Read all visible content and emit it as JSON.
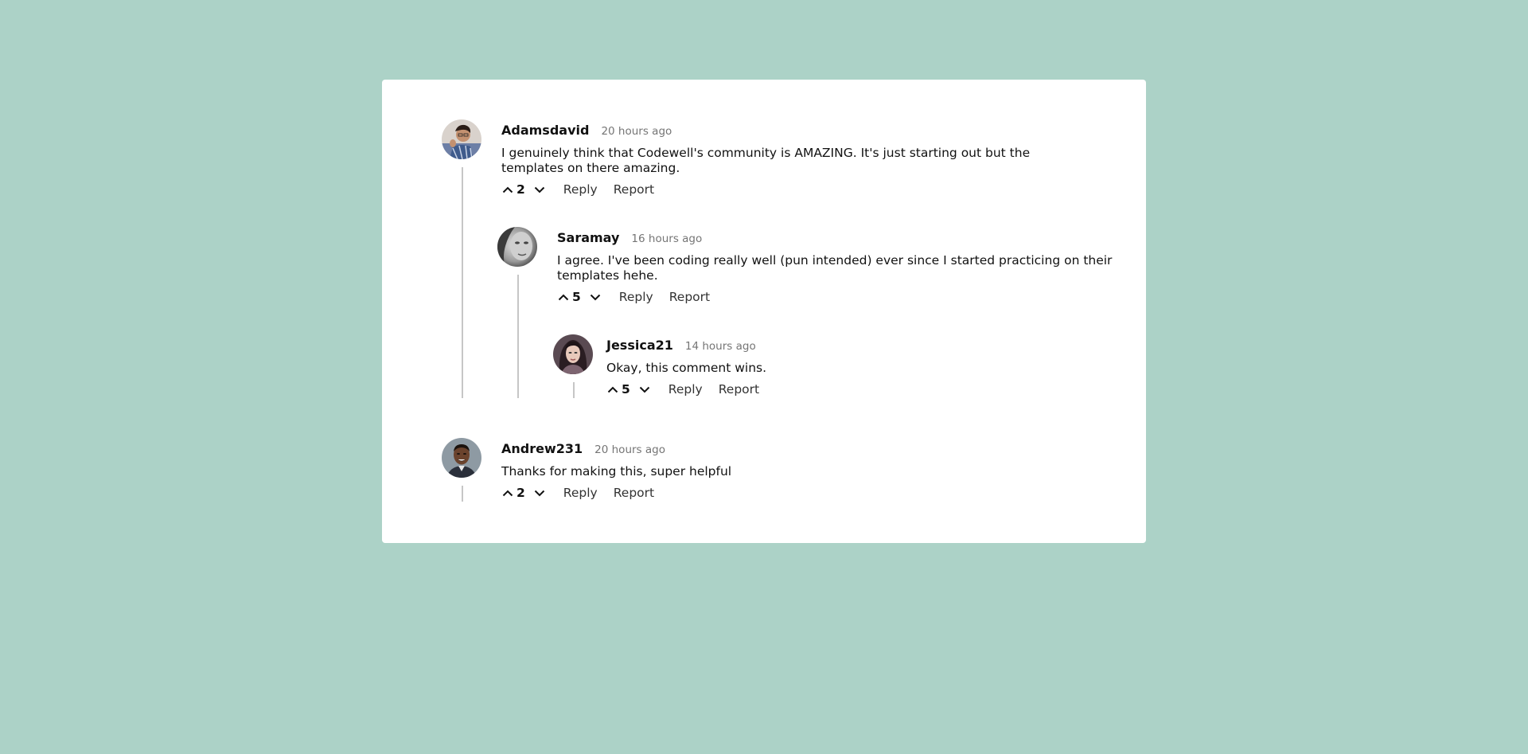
{
  "comments": [
    {
      "username": "Adamsdavid",
      "time": "20 hours ago",
      "text": "I genuinely think that Codewell's community is AMAZING. It's just starting out but the templates on there amazing.",
      "score": "2",
      "reply_label": "Reply",
      "report_label": "Report",
      "avatar_icon": "avatar-adamsdavid-icon",
      "replies": [
        {
          "username": "Saramay",
          "time": "16 hours ago",
          "text": "I agree. I've been coding really well (pun intended) ever since I started practicing on their templates hehe.",
          "score": "5",
          "reply_label": "Reply",
          "report_label": "Report",
          "avatar_icon": "avatar-saramay-icon",
          "replies": [
            {
              "username": "Jessica21",
              "time": "14 hours ago",
              "text": "Okay, this comment wins.",
              "score": "5",
              "reply_label": "Reply",
              "report_label": "Report",
              "avatar_icon": "avatar-jessica21-icon"
            }
          ]
        }
      ]
    },
    {
      "username": "Andrew231",
      "time": "20 hours ago",
      "text": "Thanks for making this, super helpful",
      "score": "2",
      "reply_label": "Reply",
      "report_label": "Report",
      "avatar_icon": "avatar-andrew231-icon"
    }
  ],
  "colors": {
    "background": "#acd2c7",
    "card": "#ffffff",
    "thread_line": "#c6c6c6",
    "timestamp": "#757575"
  }
}
